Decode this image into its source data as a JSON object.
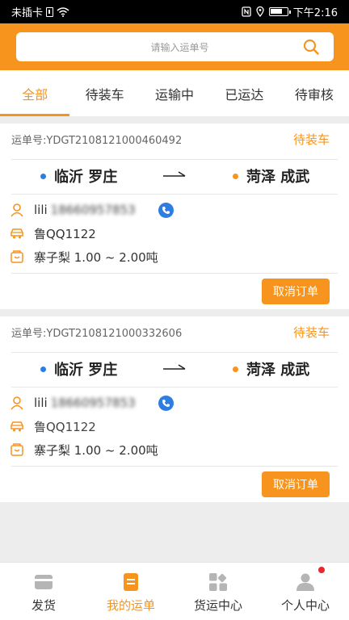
{
  "status_bar": {
    "carrier": "未插卡",
    "time": "下午2:16"
  },
  "search": {
    "placeholder": "请输入运单号"
  },
  "tabs": [
    {
      "label": "全部",
      "active": true
    },
    {
      "label": "待装车",
      "active": false
    },
    {
      "label": "运输中",
      "active": false
    },
    {
      "label": "已运达",
      "active": false
    },
    {
      "label": "待审核",
      "active": false
    }
  ],
  "orders": [
    {
      "waybill_label": "运单号:YDGT2108121000460492",
      "status": "待装车",
      "from": "临沂 罗庄",
      "to": "菏泽 成武",
      "driver": "lili",
      "phone_masked": "18660957853",
      "plate": "鲁QQ1122",
      "cargo": "寨子梨 1.00 ~ 2.00吨",
      "cancel_label": "取消订单"
    },
    {
      "waybill_label": "运单号:YDGT2108121000332606",
      "status": "待装车",
      "from": "临沂 罗庄",
      "to": "菏泽 成武",
      "driver": "lili",
      "phone_masked": "18660957853",
      "plate": "鲁QQ1122",
      "cargo": "寨子梨 1.00 ~ 2.00吨",
      "cancel_label": "取消订单"
    }
  ],
  "bottom_nav": [
    {
      "label": "发货",
      "icon": "card-icon",
      "active": false
    },
    {
      "label": "我的运单",
      "icon": "list-icon",
      "active": true
    },
    {
      "label": "货运中心",
      "icon": "grid-icon",
      "active": false
    },
    {
      "label": "个人中心",
      "icon": "person-icon",
      "active": false,
      "badge": true
    }
  ],
  "colors": {
    "accent": "#f7941d",
    "blue": "#2f7de1",
    "badge": "#e8262c"
  }
}
